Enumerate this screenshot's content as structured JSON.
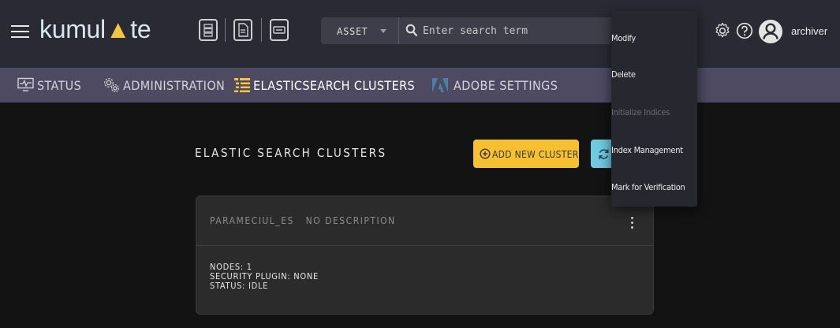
{
  "app": {
    "logo_text_1": "kumul",
    "logo_text_2": "te",
    "username": "archiver"
  },
  "search": {
    "scope": "ASSET",
    "placeholder": "Enter search term"
  },
  "nav": {
    "items": [
      {
        "label": "STATUS",
        "icon": "monitor-icon"
      },
      {
        "label": "ADMINISTRATION",
        "icon": "gears-icon"
      },
      {
        "label": "ELASTICSEARCH CLUSTERS",
        "icon": "list-icon"
      },
      {
        "label": "ADOBE SETTINGS",
        "icon": "adobe-icon"
      }
    ]
  },
  "main": {
    "title": "ELASTIC SEARCH CLUSTERS",
    "add_button": "ADD NEW CLUSTER",
    "refresh_button": "R"
  },
  "cluster": {
    "name": "PARAMECIUL_ES",
    "description": "NO DESCRIPTION",
    "nodes": "NODES: 1",
    "security": "SECURITY PLUGIN: NONE",
    "status": "STATUS: IDLE"
  },
  "menu": {
    "items": [
      {
        "label": "Modify",
        "enabled": true
      },
      {
        "label": "Delete",
        "enabled": true
      },
      {
        "label": "Initialize Indices",
        "enabled": false
      },
      {
        "label": "Index Management",
        "enabled": true
      },
      {
        "label": "Mark for Verification",
        "enabled": true
      }
    ]
  },
  "colors": {
    "topbar": "#2a2a35",
    "navbar": "#4e4a62",
    "accent_yellow": "#f6c030",
    "accent_cyan": "#6ecbe0",
    "logo_accent": "#f5c542"
  }
}
